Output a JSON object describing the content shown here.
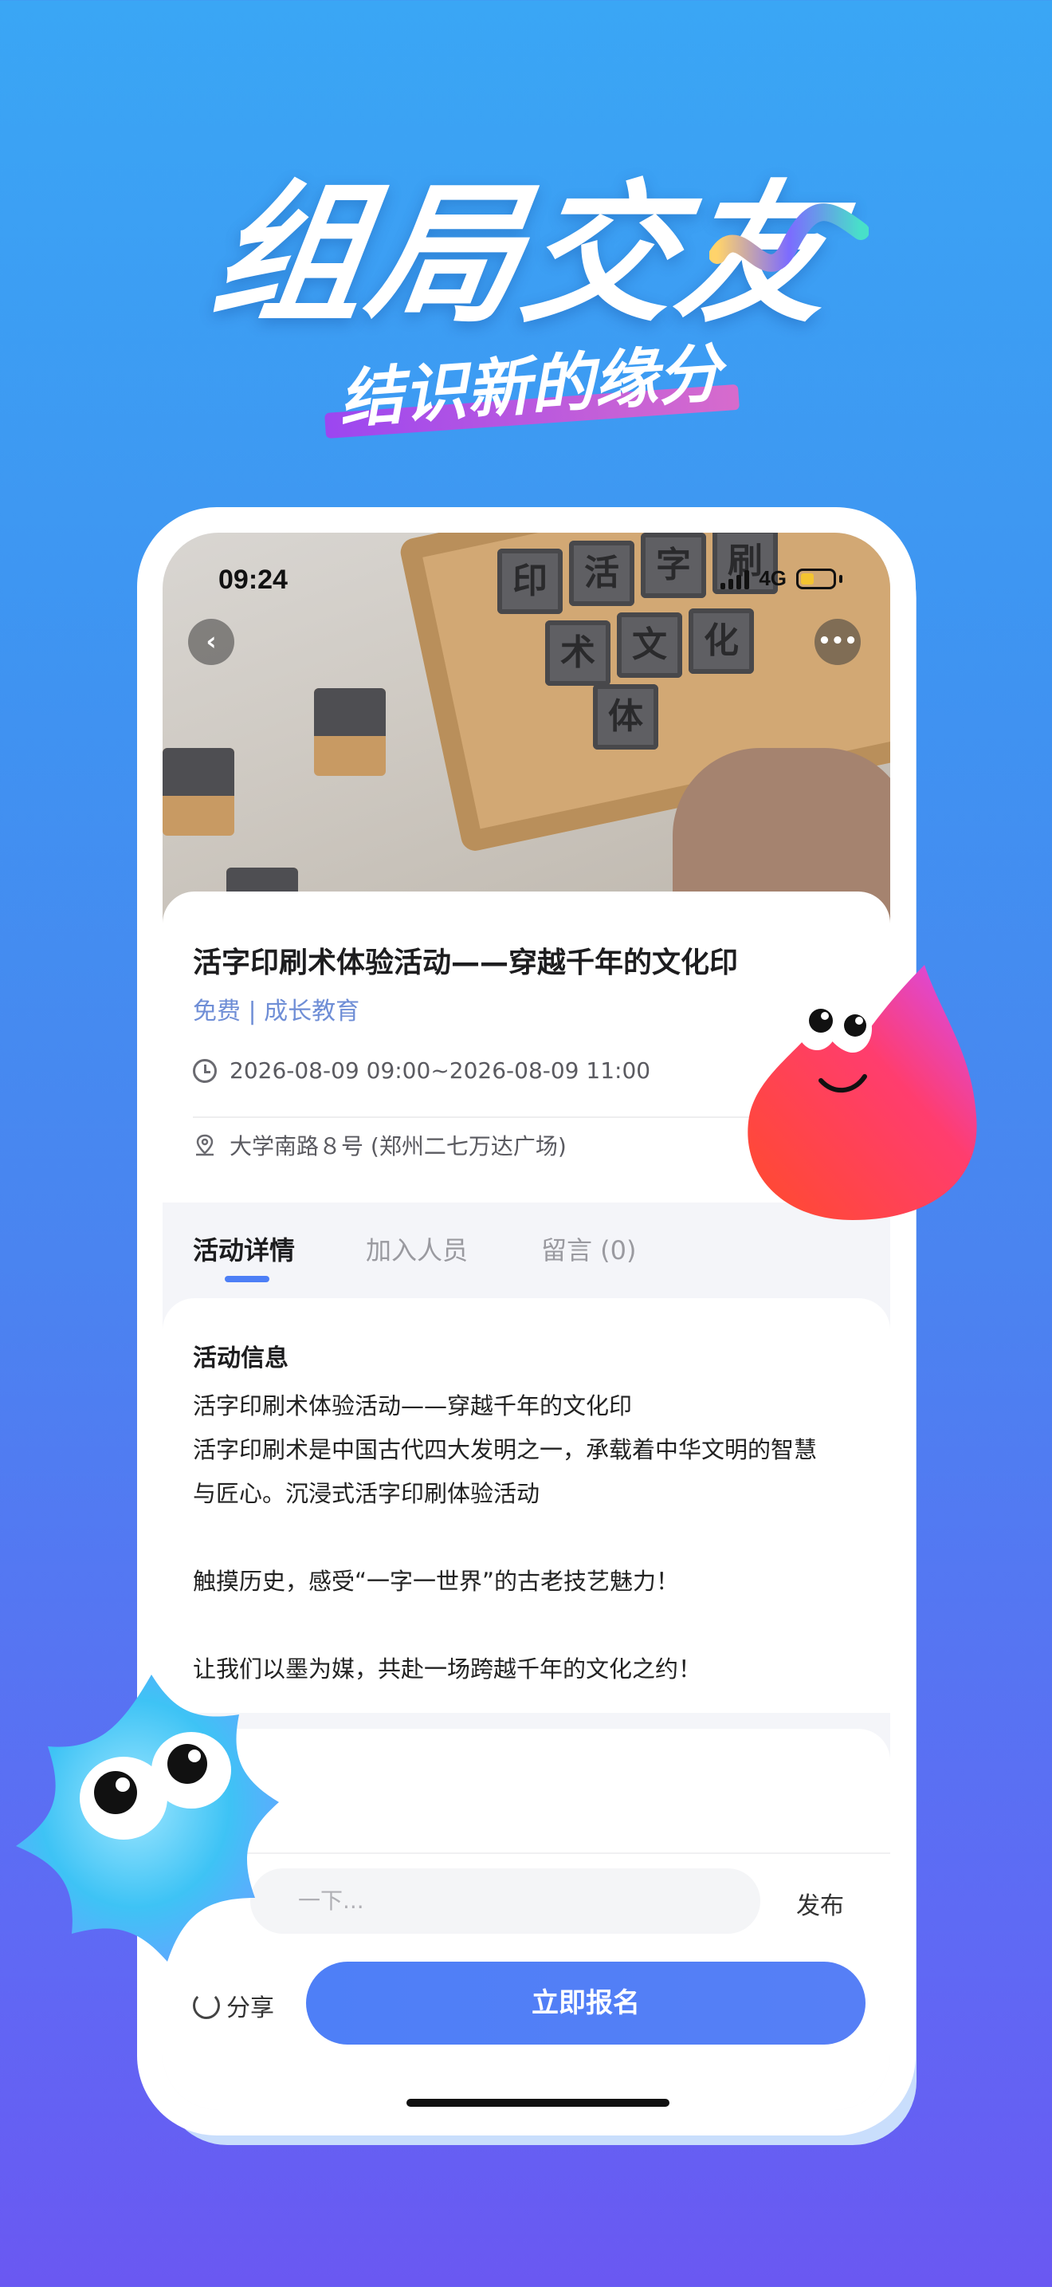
{
  "hero": {
    "title": "组局交友",
    "subtitle": "结识新的缘分"
  },
  "status_bar": {
    "time": "09:24",
    "network": "4G"
  },
  "photo": {
    "blocks": [
      "印",
      "活",
      "字",
      "刷",
      "术",
      "文",
      "化",
      "体"
    ]
  },
  "event": {
    "title": "活字印刷术体验活动——穿越千年的文化印",
    "tags": "免费 | 成长教育",
    "time": "2026-08-09 09:00~2026-08-09 11:00",
    "address": "大学南路８号 (郑州二七万达广场)"
  },
  "tabs": [
    {
      "label": "活动详情",
      "active": true
    },
    {
      "label": "加入人员",
      "active": false
    },
    {
      "label": "留言 (0)",
      "active": false
    }
  ],
  "detail": {
    "heading": "活动信息",
    "body": "活字印刷术体验活动——穿越千年的文化印\n活字印刷术是中国古代四大发明之一，承载着中华文明的智慧\n与匠心。沉浸式活字印刷体验活动\n\n触摸历史，感受“一字一世界”的古老技艺魅力！\n\n让我们以墨为媒，共赴一场跨越千年的文化之约！"
  },
  "comment": {
    "placeholder": "一下...",
    "publish_label": "发布"
  },
  "actions": {
    "share_label": "分享",
    "signup_label": "立即报名"
  },
  "colors": {
    "accent": "#4e7ff7",
    "tag": "#6f8ed6",
    "background_top": "#3aa6f5",
    "background_bottom": "#6a58f2"
  }
}
